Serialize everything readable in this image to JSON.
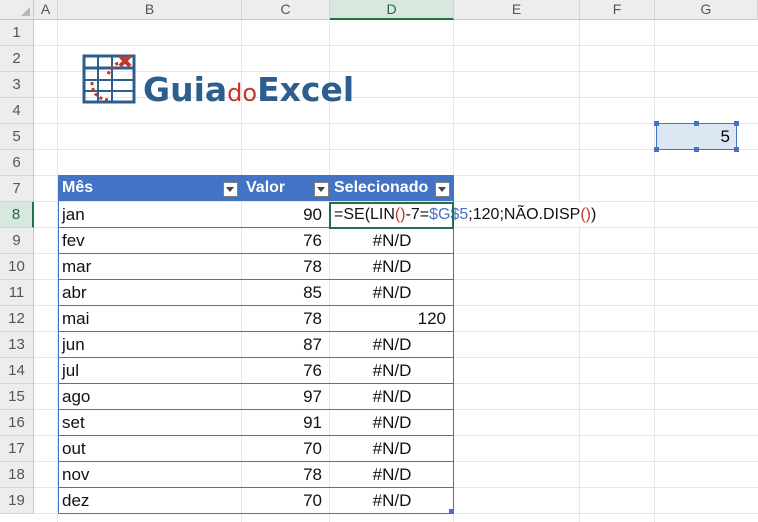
{
  "columns": [
    "A",
    "B",
    "C",
    "D",
    "E",
    "F",
    "G"
  ],
  "selected_column": "D",
  "rows": [
    "1",
    "2",
    "3",
    "4",
    "5",
    "6",
    "7",
    "8",
    "9",
    "10",
    "11",
    "12",
    "13",
    "14",
    "15",
    "16",
    "17",
    "18",
    "19"
  ],
  "selected_row": "8",
  "logo": {
    "part1": "Guia",
    "part2": "do",
    "part3": "Excel"
  },
  "g5_value": "5",
  "table": {
    "headers": [
      "Mês",
      "Valor",
      "Selecionado"
    ],
    "rows": [
      {
        "mes": "jan",
        "valor": "90",
        "sel": ""
      },
      {
        "mes": "fev",
        "valor": "76",
        "sel": "#N/D"
      },
      {
        "mes": "mar",
        "valor": "78",
        "sel": "#N/D"
      },
      {
        "mes": "abr",
        "valor": "85",
        "sel": "#N/D"
      },
      {
        "mes": "mai",
        "valor": "78",
        "sel": "120"
      },
      {
        "mes": "jun",
        "valor": "87",
        "sel": "#N/D"
      },
      {
        "mes": "jul",
        "valor": "76",
        "sel": "#N/D"
      },
      {
        "mes": "ago",
        "valor": "97",
        "sel": "#N/D"
      },
      {
        "mes": "set",
        "valor": "91",
        "sel": "#N/D"
      },
      {
        "mes": "out",
        "valor": "70",
        "sel": "#N/D"
      },
      {
        "mes": "nov",
        "valor": "78",
        "sel": "#N/D"
      },
      {
        "mes": "dez",
        "valor": "70",
        "sel": "#N/D"
      }
    ]
  },
  "formula": {
    "p1": "=SE(LIN",
    "p2": "()",
    "p3": "-7=",
    "p4": "$G$5",
    "p5": ";120;NÃO.DISP",
    "p6": "()",
    "p7": ")"
  },
  "colors": {
    "header_blue": "#4472c4",
    "selection_green": "#217346",
    "logo_blue": "#2e5e8e",
    "logo_red": "#c0392b"
  },
  "icons": [
    "filter-dropdown-icon",
    "spreadsheet-logo-icon"
  ]
}
